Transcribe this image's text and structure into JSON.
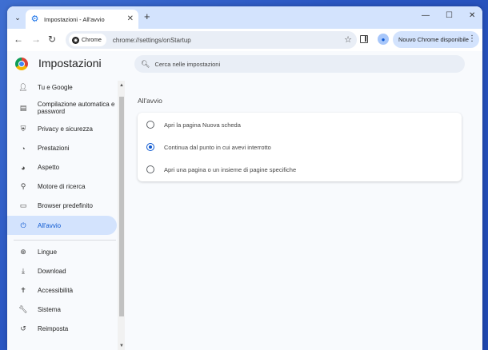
{
  "colors": {
    "accent": "#0b57d0",
    "tabstrip": "#d3e3fd",
    "page_bg": "#f8fafd"
  },
  "tab": {
    "title": "Impostazioni - All'avvio",
    "close": "✕",
    "favicon": "gear-icon"
  },
  "tabstrip": {
    "tab_search": "⌄",
    "new_tab": "+",
    "minimize": "—",
    "maximize": "☐",
    "close": "✕"
  },
  "toolbar": {
    "back": "←",
    "forward": "→",
    "reload": "↻",
    "site_chip": "Chrome",
    "url": "chrome://settings/onStartup",
    "bookmark": "☆",
    "update_button": "Nouvo Chrome disponibile",
    "menu": "⋮"
  },
  "settings": {
    "title": "Impostazioni",
    "search_placeholder": "Cerca nelle impostazioni"
  },
  "sidebar": {
    "items": [
      {
        "label": "Tu e Google",
        "icon": "person-icon"
      },
      {
        "label": "Compilazione automatica e password",
        "icon": "clipboard-icon"
      },
      {
        "label": "Privacy e sicurezza",
        "icon": "shield-icon"
      },
      {
        "label": "Prestazioni",
        "icon": "speedometer-icon"
      },
      {
        "label": "Aspetto",
        "icon": "palette-icon"
      },
      {
        "label": "Motore di ricerca",
        "icon": "search-icon"
      },
      {
        "label": "Browser predefinito",
        "icon": "browser-icon"
      },
      {
        "label": "All'avvio",
        "icon": "power-icon",
        "active": true
      },
      {
        "label": "Lingue",
        "icon": "globe-icon"
      },
      {
        "label": "Download",
        "icon": "download-icon"
      },
      {
        "label": "Accessibilità",
        "icon": "accessibility-icon"
      },
      {
        "label": "Sistema",
        "icon": "wrench-icon"
      },
      {
        "label": "Reimposta",
        "icon": "reset-icon"
      }
    ]
  },
  "main": {
    "section_title": "All'avvio",
    "options": [
      {
        "label": "Apri la pagina Nuova scheda",
        "checked": false
      },
      {
        "label": "Continua dal punto in cui avevi interrotto",
        "checked": true
      },
      {
        "label": "Apri una pagina o un insieme di pagine specifiche",
        "checked": false
      }
    ]
  }
}
